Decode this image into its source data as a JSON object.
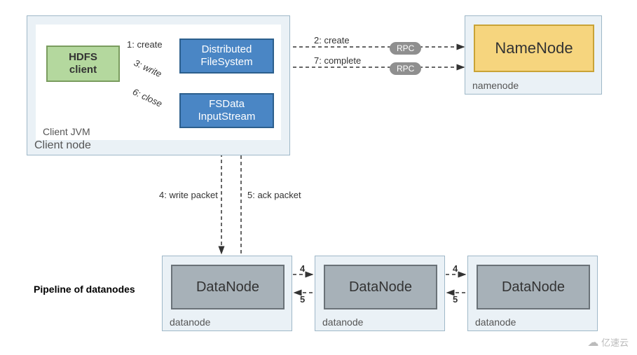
{
  "client_node": {
    "label": "Client node",
    "jvm_label": "Client JVM",
    "hdfs_client": "HDFS\nclient",
    "dist_fs": "Distributed\nFileSystem",
    "fsdata": "FSData\nInputStream"
  },
  "namenode": {
    "container_label": "namenode",
    "box": "NameNode"
  },
  "datanode": {
    "container_label": "datanode",
    "box": "DataNode"
  },
  "pipeline_label": "Pipeline of datanodes",
  "rpc": "RPC",
  "arrows": {
    "create1": "1: create",
    "create2": "2: create",
    "write": "3: write",
    "write_packet": "4: write packet",
    "ack_packet": "5: ack packet",
    "close": "6: close",
    "complete": "7: complete",
    "four": "4",
    "five": "5"
  },
  "watermark": "亿速云"
}
